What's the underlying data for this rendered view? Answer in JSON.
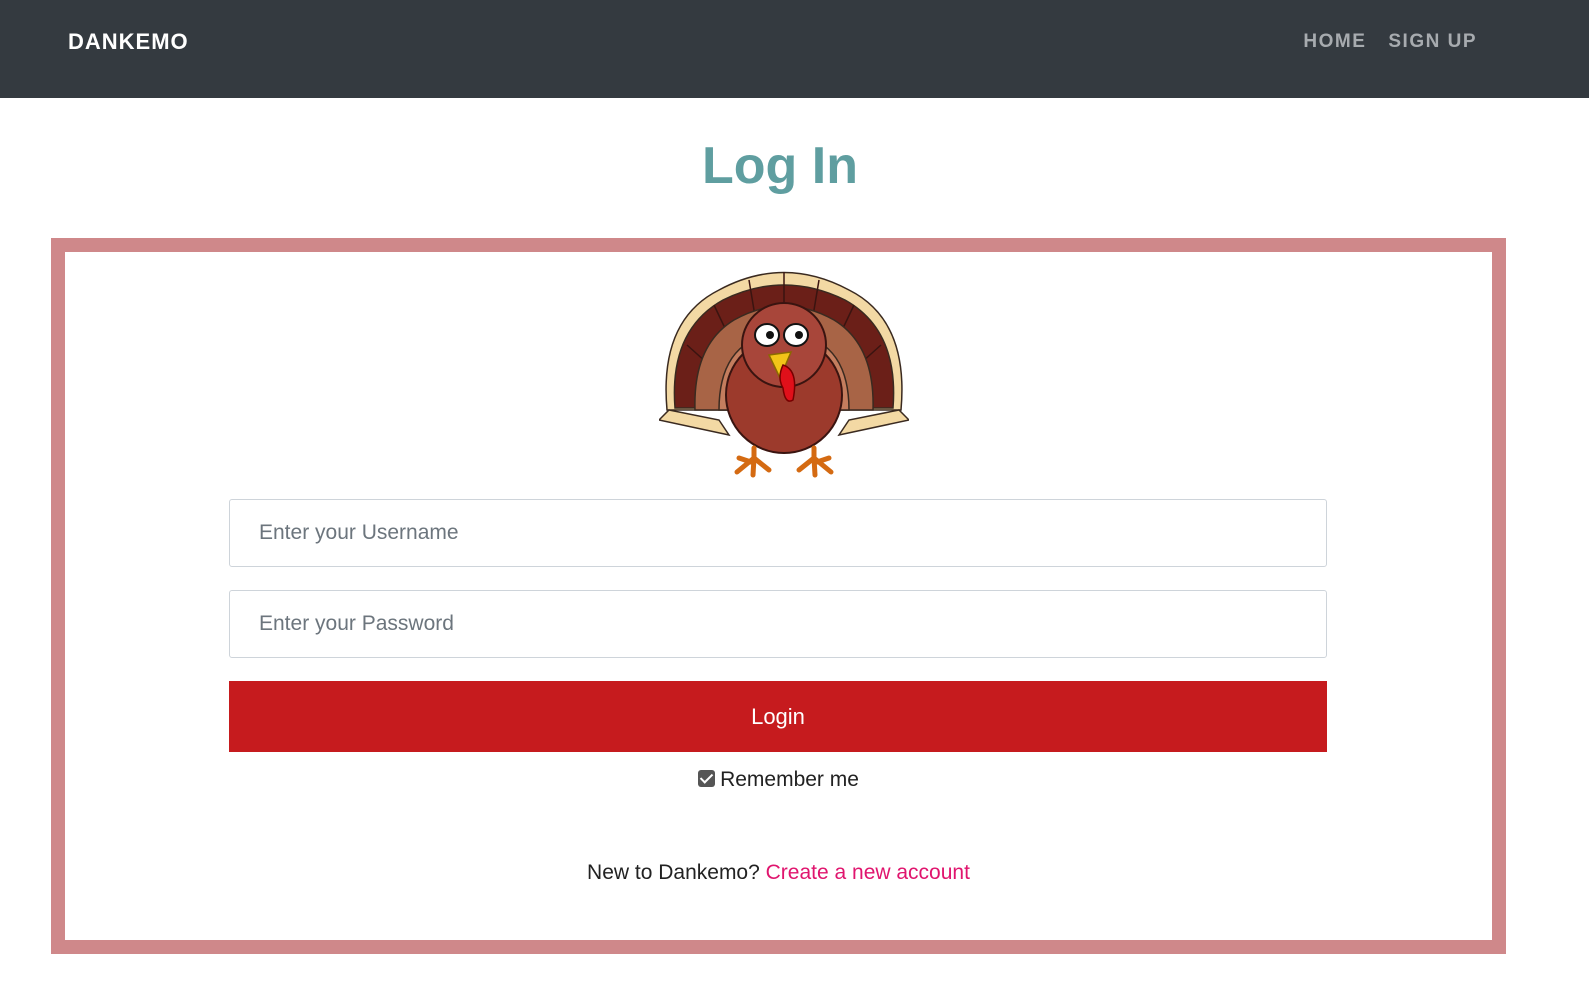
{
  "navbar": {
    "brand": "DANKEMO",
    "links": [
      "HOME",
      "SIGN UP"
    ]
  },
  "page": {
    "title": "Log In"
  },
  "form": {
    "username_placeholder": "Enter your Username",
    "password_placeholder": "Enter your Password",
    "login_label": "Login",
    "remember_label": "Remember me",
    "remember_checked": true,
    "signup_prompt": "New to Dankemo?",
    "signup_link": "Create a new account"
  },
  "images": {
    "logo": "turkey-mascot"
  },
  "colors": {
    "navbar_bg": "#343a40",
    "title": "#5f9ea0",
    "card_border": "#cf888a",
    "login_button": "#c61b1e",
    "link": "#e0156e"
  }
}
